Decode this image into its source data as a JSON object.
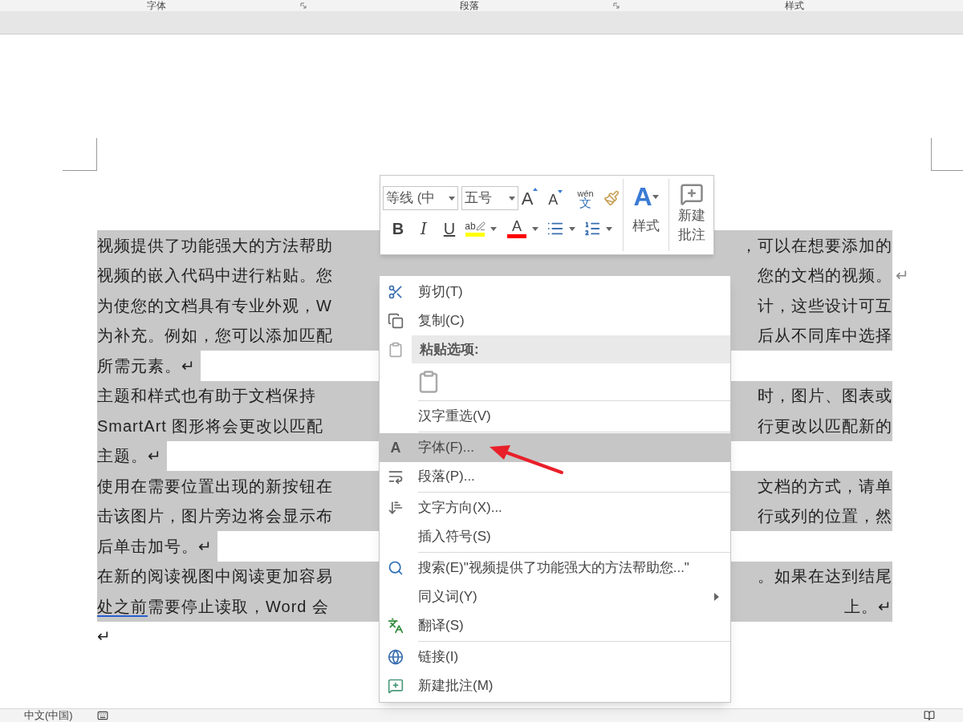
{
  "ribbon": {
    "groups": [
      {
        "label": "字体",
        "launcher": true
      },
      {
        "label": "段落",
        "launcher": true
      },
      {
        "label": "样式",
        "launcher": false
      }
    ]
  },
  "document": {
    "lines": [
      {
        "kind": "split",
        "selected": true,
        "left": [
          {
            "text": "视频提供了功能强大的方法帮助",
            "underline": false
          }
        ],
        "right": "，可以在想要添加的"
      },
      {
        "kind": "split",
        "selected": true,
        "left": [
          {
            "text": "视频的嵌入代码中进行粘贴。您",
            "underline": false
          }
        ],
        "right": "您的文档的视频。",
        "end_mark": "↵"
      },
      {
        "kind": "split",
        "selected": true,
        "left": [
          {
            "text": "为使您的文档具有专业外观，W",
            "underline": false
          }
        ],
        "right": "计，这些设计可互"
      },
      {
        "kind": "split",
        "selected": true,
        "left": [
          {
            "text": "为补充。例如，您可以添加匹配",
            "underline": false
          }
        ],
        "right": "后从不同库中选择"
      },
      {
        "kind": "end",
        "selected": true,
        "text": "所需元素。↵"
      },
      {
        "kind": "split",
        "selected": true,
        "left": [
          {
            "text": "主题和样式也有助于文档保持",
            "underline": false
          }
        ],
        "right": "时，图片、图表或"
      },
      {
        "kind": "split",
        "selected": true,
        "left": [
          {
            "text": "SmartArt 图形将会更改以匹配",
            "underline": false
          }
        ],
        "right": "行更改以匹配新的"
      },
      {
        "kind": "end",
        "selected": true,
        "text": "主题。↵"
      },
      {
        "kind": "split",
        "selected": true,
        "left": [
          {
            "text": "使用在需要位置出现的新按钮在",
            "underline": false
          }
        ],
        "right": "文档的方式，请单"
      },
      {
        "kind": "split",
        "selected": true,
        "left": [
          {
            "text": "击该图片，图片旁边将会显示布",
            "underline": false
          }
        ],
        "right": "行或列的位置，然"
      },
      {
        "kind": "end",
        "selected": true,
        "text": "后单击加号。↵"
      },
      {
        "kind": "split",
        "selected": true,
        "left": [
          {
            "text": "在新的阅读视图中阅读更加容易",
            "underline": false
          }
        ],
        "right": "。如果在达到结尾"
      },
      {
        "kind": "split",
        "selected": true,
        "left": [
          {
            "text": "处之前",
            "underline": true
          },
          {
            "text": "需要停止读取，Word 会",
            "underline": false
          }
        ],
        "right": "上。↵"
      },
      {
        "kind": "end",
        "selected": false,
        "text": "↵"
      }
    ]
  },
  "mini_toolbar": {
    "font_name": "等线 (中",
    "font_size": "五号",
    "grow_font": "A",
    "shrink_font": "A",
    "phonetic": {
      "pinyin": "wén",
      "char": "文"
    },
    "format": [
      {
        "kind": "bold",
        "label": "B"
      },
      {
        "kind": "italic",
        "label": "I"
      },
      {
        "kind": "underline",
        "label": "U"
      }
    ],
    "highlight": {
      "label": "ab",
      "color": "#ffff00"
    },
    "font_color": {
      "label": "A",
      "color": "#ff0000"
    },
    "styles": {
      "icon_text": "A",
      "label": "样式"
    },
    "comment": {
      "label": "新建批注"
    }
  },
  "menu": {
    "items": [
      {
        "kind": "item",
        "label": "剪切(T)",
        "selected": false,
        "submenu": false
      },
      {
        "kind": "item",
        "label": "复制(C)",
        "selected": false,
        "submenu": false
      },
      {
        "kind": "header",
        "label": "粘贴选项:"
      },
      {
        "kind": "paste-options"
      },
      {
        "kind": "separator"
      },
      {
        "kind": "item",
        "label": "汉字重选(V)",
        "selected": false,
        "submenu": false
      },
      {
        "kind": "separator"
      },
      {
        "kind": "item",
        "label": "字体(F)...",
        "icon_text": "A",
        "selected": true,
        "submenu": false
      },
      {
        "kind": "item",
        "label": "段落(P)...",
        "selected": false,
        "submenu": false
      },
      {
        "kind": "separator"
      },
      {
        "kind": "item",
        "label": "文字方向(X)...",
        "selected": false,
        "submenu": false
      },
      {
        "kind": "item",
        "label": "插入符号(S)",
        "selected": false,
        "submenu": false
      },
      {
        "kind": "separator"
      },
      {
        "kind": "item",
        "label": "搜索(E)\"视频提供了功能强大的方法帮助您...\"",
        "selected": false,
        "submenu": false
      },
      {
        "kind": "item",
        "label": "同义词(Y)",
        "selected": false,
        "submenu": true
      },
      {
        "kind": "item",
        "label": "翻译(S)",
        "selected": false,
        "submenu": false
      },
      {
        "kind": "separator"
      },
      {
        "kind": "item",
        "label": "链接(I)",
        "selected": false,
        "submenu": false
      },
      {
        "kind": "item",
        "label": "新建批注(M)",
        "selected": false,
        "submenu": false
      }
    ]
  },
  "status_bar": {
    "language": "中文(中国)"
  }
}
